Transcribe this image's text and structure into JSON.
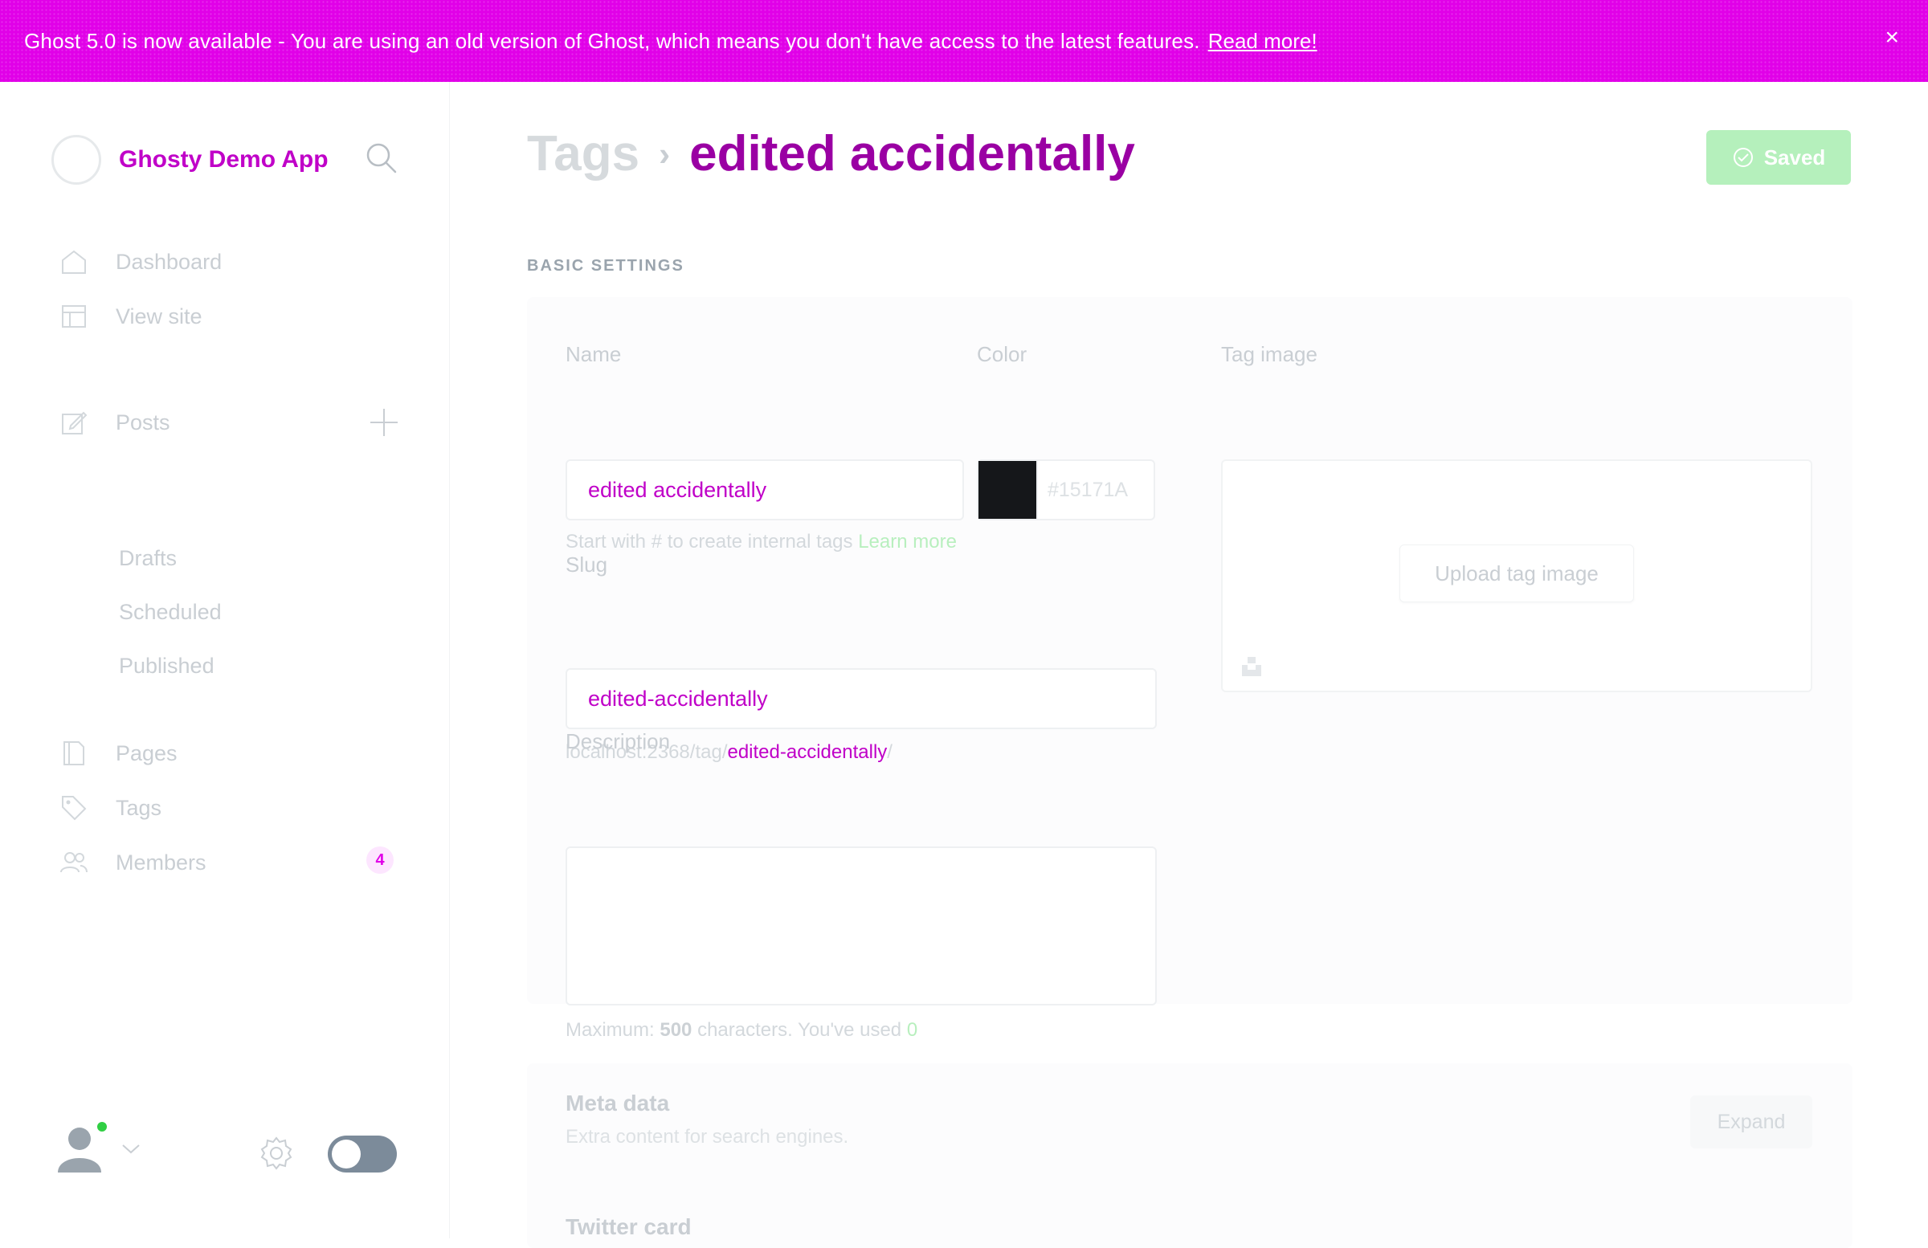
{
  "banner": {
    "message": "Ghost 5.0 is now available - You are using an old version of Ghost, which means you don't have access to the latest features.",
    "link": "Read more!",
    "close": "×"
  },
  "sidebar": {
    "site_name": "Ghosty Demo App",
    "nav": {
      "dashboard": "Dashboard",
      "view_site": "View site",
      "posts": "Posts",
      "drafts": "Drafts",
      "scheduled": "Scheduled",
      "published": "Published",
      "pages": "Pages",
      "tags": "Tags",
      "members": "Members"
    },
    "members_badge": "4",
    "icons": [
      "home-icon",
      "view-site-icon",
      "posts-icon",
      "plus-icon",
      "pages-icon",
      "tag-icon",
      "members-icon",
      "search-icon",
      "gear-icon"
    ]
  },
  "header": {
    "breadcrumb_parent": "Tags",
    "breadcrumb_sep": "›",
    "current_tag": "edited accidentally",
    "saved_label": "Saved"
  },
  "basic_settings": {
    "section_label": "BASIC SETTINGS",
    "name_label": "Name",
    "name_value": "edited accidentally",
    "name_hint": "Start with # to create internal tags",
    "name_hint_link": "Learn more",
    "color_label": "Color",
    "color_value": "#15171A",
    "tag_image_label": "Tag image",
    "upload_label": "Upload tag image",
    "slug_label": "Slug",
    "slug_value": "edited-accidentally",
    "slug_url_prefix": "localhost:2368/tag/",
    "slug_url_slug": "edited-accidentally",
    "slug_url_suffix": "/",
    "description_label": "Description",
    "description_value": "",
    "desc_hint_prefix": "Maximum:",
    "desc_hint_max": "500",
    "desc_hint_middle": "characters. You've used",
    "desc_hint_used": "0"
  },
  "expandables": {
    "meta_title": "Meta data",
    "meta_sub": "Extra content for search engines.",
    "expand_label": "Expand",
    "twitter_title": "Twitter card"
  },
  "colors": {
    "accent": "#e100e8",
    "saved_green": "#b5f0bc",
    "online_dot": "#30cf43",
    "tag_color": "#15171A"
  }
}
